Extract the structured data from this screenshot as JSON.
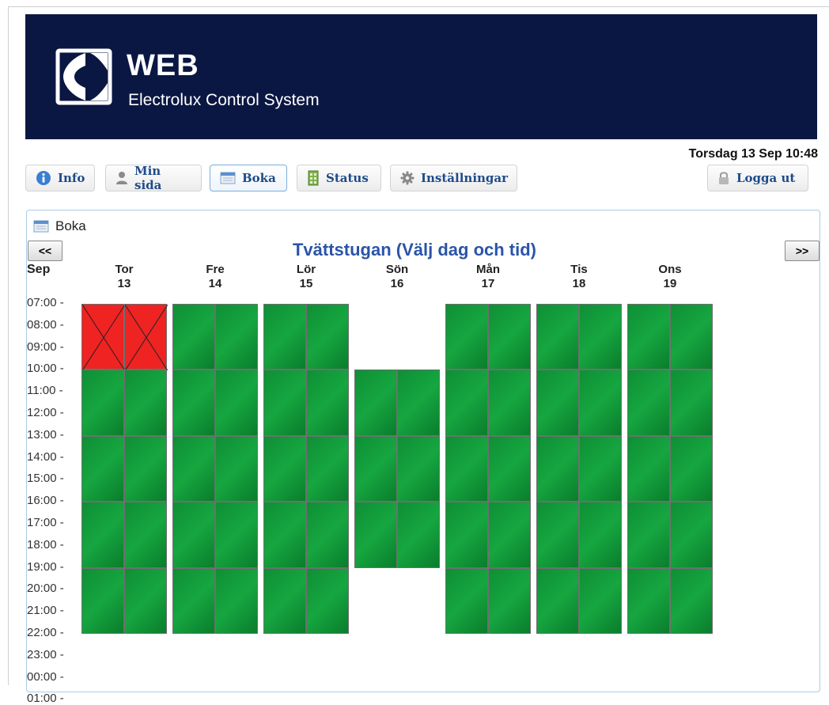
{
  "header": {
    "title": "WEB",
    "subtitle": "Electrolux Control System",
    "datetime": "Torsdag 13 Sep 10:48"
  },
  "nav": {
    "info": "Info",
    "min_sida": "Min sida",
    "boka": "Boka",
    "status": "Status",
    "installningar": "Inställningar",
    "logga_ut": "Logga ut",
    "active": "Boka"
  },
  "panel": {
    "title": "Boka"
  },
  "calendar": {
    "title": "Tvättstugan (Välj dag och tid)",
    "prev": "<<",
    "next": ">>",
    "month": "Sep",
    "times": [
      "07:00 -",
      "08:00 -",
      "09:00 -",
      "10:00 -",
      "11:00 -",
      "12:00 -",
      "13:00 -",
      "14:00 -",
      "15:00 -",
      "16:00 -",
      "17:00 -",
      "18:00 -",
      "19:00 -",
      "20:00 -",
      "21:00 -",
      "22:00 -",
      "23:00 -",
      "00:00 -",
      "01:00 -"
    ],
    "days": [
      {
        "name": "Tor",
        "date": "13"
      },
      {
        "name": "Fre",
        "date": "14"
      },
      {
        "name": "Lör",
        "date": "15"
      },
      {
        "name": "Sön",
        "date": "16"
      },
      {
        "name": "Mån",
        "date": "17"
      },
      {
        "name": "Tis",
        "date": "18"
      },
      {
        "name": "Ons",
        "date": "19"
      }
    ],
    "slots": [
      {
        "day": 0,
        "start": 7,
        "end": 10,
        "status": "booked"
      },
      {
        "day": 0,
        "start": 10,
        "end": 13,
        "status": "available"
      },
      {
        "day": 0,
        "start": 13,
        "end": 16,
        "status": "available"
      },
      {
        "day": 0,
        "start": 16,
        "end": 19,
        "status": "available"
      },
      {
        "day": 0,
        "start": 19,
        "end": 22,
        "status": "available"
      },
      {
        "day": 1,
        "start": 7,
        "end": 10,
        "status": "available"
      },
      {
        "day": 1,
        "start": 10,
        "end": 13,
        "status": "available"
      },
      {
        "day": 1,
        "start": 13,
        "end": 16,
        "status": "available"
      },
      {
        "day": 1,
        "start": 16,
        "end": 19,
        "status": "available"
      },
      {
        "day": 1,
        "start": 19,
        "end": 22,
        "status": "available"
      },
      {
        "day": 2,
        "start": 7,
        "end": 10,
        "status": "available"
      },
      {
        "day": 2,
        "start": 10,
        "end": 13,
        "status": "available"
      },
      {
        "day": 2,
        "start": 13,
        "end": 16,
        "status": "available"
      },
      {
        "day": 2,
        "start": 16,
        "end": 19,
        "status": "available"
      },
      {
        "day": 2,
        "start": 19,
        "end": 22,
        "status": "available"
      },
      {
        "day": 3,
        "start": 10,
        "end": 13,
        "status": "available"
      },
      {
        "day": 3,
        "start": 13,
        "end": 16,
        "status": "available"
      },
      {
        "day": 3,
        "start": 16,
        "end": 19,
        "status": "available"
      },
      {
        "day": 4,
        "start": 7,
        "end": 10,
        "status": "available"
      },
      {
        "day": 4,
        "start": 10,
        "end": 13,
        "status": "available"
      },
      {
        "day": 4,
        "start": 13,
        "end": 16,
        "status": "available"
      },
      {
        "day": 4,
        "start": 16,
        "end": 19,
        "status": "available"
      },
      {
        "day": 4,
        "start": 19,
        "end": 22,
        "status": "available"
      },
      {
        "day": 5,
        "start": 7,
        "end": 10,
        "status": "available"
      },
      {
        "day": 5,
        "start": 10,
        "end": 13,
        "status": "available"
      },
      {
        "day": 5,
        "start": 13,
        "end": 16,
        "status": "available"
      },
      {
        "day": 5,
        "start": 16,
        "end": 19,
        "status": "available"
      },
      {
        "day": 5,
        "start": 19,
        "end": 22,
        "status": "available"
      },
      {
        "day": 6,
        "start": 7,
        "end": 10,
        "status": "available"
      },
      {
        "day": 6,
        "start": 10,
        "end": 13,
        "status": "available"
      },
      {
        "day": 6,
        "start": 13,
        "end": 16,
        "status": "available"
      },
      {
        "day": 6,
        "start": 16,
        "end": 19,
        "status": "available"
      },
      {
        "day": 6,
        "start": 19,
        "end": 22,
        "status": "available"
      }
    ]
  },
  "colors": {
    "banner": "#0a1742",
    "available": "#16a640",
    "booked": "#ee2322",
    "calendar_title": "#2b54a8"
  },
  "icons": {
    "logo": "electrolux-logo-icon",
    "info": "info-icon",
    "user": "user-icon",
    "calendar": "calendar-icon",
    "status": "building-icon",
    "settings": "gear-icon",
    "logout": "lock-icon"
  }
}
